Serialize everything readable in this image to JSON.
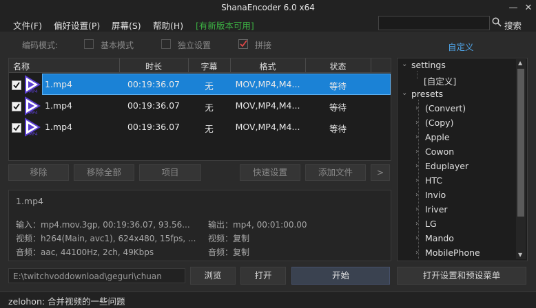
{
  "window": {
    "title": "ShanaEncoder 6.0 x64"
  },
  "menu": {
    "file": "文件(F)",
    "prefs": "偏好设置(P)",
    "screen": "屏幕(S)",
    "help": "帮助(H)",
    "update": "[有新版本可用]",
    "search_btn": "搜索"
  },
  "options": {
    "mode_label": "编码模式:",
    "basic": "基本模式",
    "independent": "独立设置",
    "concat": "拼接",
    "custom_link": "自定义"
  },
  "table": {
    "headers": {
      "name": "名称",
      "duration": "时长",
      "subtitle": "字幕",
      "format": "格式",
      "status": "状态"
    },
    "rows": [
      {
        "name": "1.mp4",
        "duration": "00:19:36.07",
        "subtitle": "无",
        "format": "MOV,MP4,M4...",
        "status": "等待"
      },
      {
        "name": "1.mp4",
        "duration": "00:19:36.07",
        "subtitle": "无",
        "format": "MOV,MP4,M4...",
        "status": "等待"
      },
      {
        "name": "1.mp4",
        "duration": "00:19:36.07",
        "subtitle": "无",
        "format": "MOV,MP4,M4...",
        "status": "等待"
      }
    ],
    "icon_label": "MP4"
  },
  "buttons": {
    "remove": "移除",
    "remove_all": "移除全部",
    "item": "项目",
    "quick": "快速设置",
    "add_file": "添加文件",
    "more": ">",
    "browse": "浏览",
    "open": "打开",
    "start": "开始",
    "open_settings": "打开设置和预设菜单"
  },
  "info": {
    "title": "1.mp4",
    "input": "输入：mp4.mov.3gp, 00:19:36.07, 93.56...",
    "video_in": "视频：h264(Main, avc1), 624x480, 15fps, ...",
    "audio_in": "音频：aac, 44100Hz, 2ch, 49Kbps",
    "output": "输出：mp4, 00:01:00.00",
    "video_out": "视频：复制",
    "audio_out": "音频：复制"
  },
  "path": "E:\\twitchvoddownload\\geguri\\chuan",
  "tree": {
    "settings": "settings",
    "custom": "[自定义]",
    "presets": "presets",
    "items": [
      "(Convert)",
      "(Copy)",
      "Apple",
      "Cowon",
      "Eduplayer",
      "HTC",
      "Invio",
      "Iriver",
      "LG",
      "Mando",
      "MobilePhone"
    ]
  },
  "status": "zelohon: 合并视频的一些问题"
}
